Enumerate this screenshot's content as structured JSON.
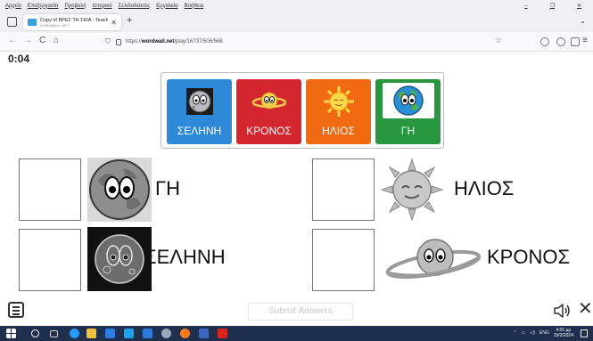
{
  "browser": {
    "menu_items": [
      "Αρχείο",
      "Επεξεργασία",
      "Προβολή",
      "Ιστορικό",
      "Σελιδοδείκτες",
      "Εργαλεία",
      "Βοήθεια"
    ],
    "window_controls": {
      "minimize": "–",
      "restore": "❐",
      "close": "✕"
    },
    "tab": {
      "title": "Copy of ΒΡΕΣ ΤΗ ΣΚΙΑ - Teach",
      "subtitle": "WORDWALL.NET",
      "close": "✕"
    },
    "new_tab": "+",
    "tab_overflow": "⌄",
    "nav": {
      "back": "←",
      "forward": "→",
      "reload": "C",
      "home": "⌂"
    },
    "url": {
      "prefix": "https://",
      "domain": "wordwall.net",
      "path": "/play/16737/506/566"
    },
    "bookmark": "☆",
    "menu": "≡"
  },
  "game": {
    "timer": "0:04",
    "cards": [
      {
        "label": "ΣΕΛΗΝΗ",
        "color": "#2e8ad8",
        "icon": "moon-icon"
      },
      {
        "label": "ΚΡΟΝΟΣ",
        "color": "#d4262f",
        "icon": "saturn-icon"
      },
      {
        "label": "ΗΛΙΟΣ",
        "color": "#f06a12",
        "icon": "sun-icon"
      },
      {
        "label": "ΓΗ",
        "color": "#27963f",
        "icon": "earth-icon"
      }
    ],
    "items": [
      {
        "label": "ΓΗ",
        "icon": "earth-shadow-icon"
      },
      {
        "label": "ΗΛΙΟΣ",
        "icon": "sun-shadow-icon"
      },
      {
        "label": "ΣΕΛΗΝΗ",
        "icon": "moon-shadow-icon"
      },
      {
        "label": "ΚΡΟΝΟΣ",
        "icon": "saturn-shadow-icon"
      }
    ],
    "submit_label": "Submit Answers",
    "close": "✕"
  },
  "taskbar": {
    "language": "ENG",
    "time": "4:01 μμ",
    "date": "15/2/2024"
  }
}
